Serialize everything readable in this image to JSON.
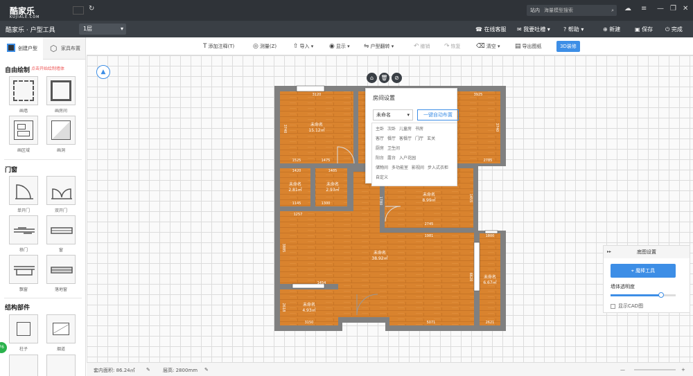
{
  "app": {
    "logo": "酷家乐",
    "logo_sub": "KUJIALE.COM",
    "title": "酷家乐 · 户型工具",
    "floor": "1层"
  },
  "search": {
    "scope": "站内",
    "placeholder": "海量模型搜索"
  },
  "menu_right": [
    {
      "label": "在线客服",
      "icon": "headset-icon"
    },
    {
      "label": "我要吐槽",
      "icon": "chat-icon"
    },
    {
      "label": "帮助",
      "icon": "help-icon"
    },
    {
      "label": "新建",
      "icon": "new-icon"
    },
    {
      "label": "保存",
      "icon": "save-icon"
    },
    {
      "label": "完成",
      "icon": "power-icon"
    }
  ],
  "left_panel": {
    "tabs": [
      "创建户型",
      "家具布置"
    ],
    "sections": {
      "free_draw": "自由绘制",
      "free_draw_hint": "点击开始绘制墙体",
      "doors_windows": "门窗",
      "structure": "结构部件"
    },
    "draw_tools": [
      "画墙",
      "画房间",
      "画区域",
      "画洞"
    ],
    "door_tools": [
      "单开门",
      "双开门",
      "移门",
      "窗",
      "飘窗",
      "落地窗"
    ],
    "struct_tools": [
      "柱子",
      "烟道"
    ]
  },
  "toolbar": [
    {
      "label": "添加注释(T)",
      "icon": "text-icon",
      "disabled": false
    },
    {
      "label": "测量(Z)",
      "icon": "measure-icon",
      "disabled": false
    },
    {
      "label": "导入",
      "icon": "import-icon",
      "disabled": false
    },
    {
      "label": "显示",
      "icon": "eye-icon",
      "disabled": false
    },
    {
      "label": "户型翻转",
      "icon": "flip-icon",
      "disabled": false
    },
    {
      "label": "撤销",
      "icon": "undo-icon",
      "disabled": true
    },
    {
      "label": "恢复",
      "icon": "redo-icon",
      "disabled": true
    },
    {
      "label": "清空",
      "icon": "clear-icon",
      "disabled": false
    },
    {
      "label": "导出图纸",
      "icon": "export-icon",
      "disabled": false
    }
  ],
  "toolbar_3d": "3D装修",
  "popup": {
    "title": "房间设置",
    "selected": "未命名",
    "auto_btn": "一键自动布置",
    "room_rows": [
      [
        "主卧",
        "次卧",
        "儿童房",
        "书房"
      ],
      [
        "客厅",
        "餐厅",
        "客餐厅",
        "门厅",
        "玄关"
      ],
      [
        "厨房",
        "卫生间"
      ],
      [
        "阳台",
        "露台",
        "入户花园"
      ],
      [
        "储物间",
        "多功能室",
        "影视间",
        "步入式衣柜"
      ],
      [
        "自定义"
      ]
    ]
  },
  "rooms": [
    {
      "name": "未命名",
      "area": "15.12㎡"
    },
    {
      "name": "未命名",
      "area": "2.81㎡"
    },
    {
      "name": "未命名",
      "area": "2.93㎡"
    },
    {
      "name": "未命名",
      "area": "8.99㎡"
    },
    {
      "name": "未命名",
      "area": "38.92㎡"
    },
    {
      "name": "未命名",
      "area": "4.93㎡"
    },
    {
      "name": "未命名",
      "area": "6.67㎡"
    }
  ],
  "dims": [
    "3120",
    "3925",
    "3740",
    "1525",
    "1475",
    "1420",
    "1485",
    "1145",
    "1300",
    "1257",
    "3740",
    "2785",
    "1780",
    "1455",
    "2745",
    "1981",
    "3885",
    "6620",
    "1454",
    "2618",
    "3150",
    "5071",
    "2621",
    "1800",
    "3790",
    "1770"
  ],
  "bg_panel": {
    "title": "底图设置",
    "magic": "魔棒工具",
    "opacity_label": "墙体透明度",
    "opacity": 0.78,
    "cad": "显示CAD图"
  },
  "status": {
    "area": "套内面积: 86.24㎡",
    "height": "层高: 2800mm"
  },
  "float_badge": "76",
  "colors": {
    "accent": "#3d8ee6",
    "wall": "#808080",
    "floor": "#d9832e"
  }
}
